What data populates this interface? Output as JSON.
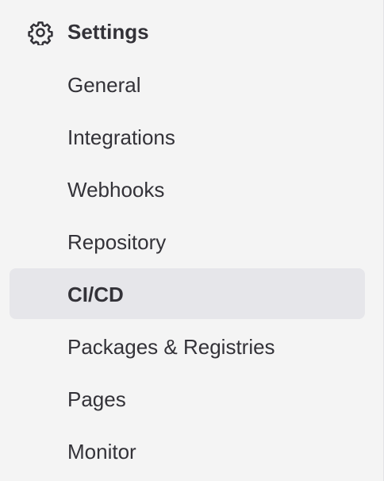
{
  "section": {
    "title": "Settings",
    "icon": "gear-icon"
  },
  "nav": {
    "items": [
      {
        "label": "General",
        "active": false
      },
      {
        "label": "Integrations",
        "active": false
      },
      {
        "label": "Webhooks",
        "active": false
      },
      {
        "label": "Repository",
        "active": false
      },
      {
        "label": "CI/CD",
        "active": true
      },
      {
        "label": "Packages & Registries",
        "active": false
      },
      {
        "label": "Pages",
        "active": false
      },
      {
        "label": "Monitor",
        "active": false
      }
    ]
  },
  "colors": {
    "background": "#f4f4f4",
    "active_background": "#e6e6ea",
    "text": "#333238"
  }
}
